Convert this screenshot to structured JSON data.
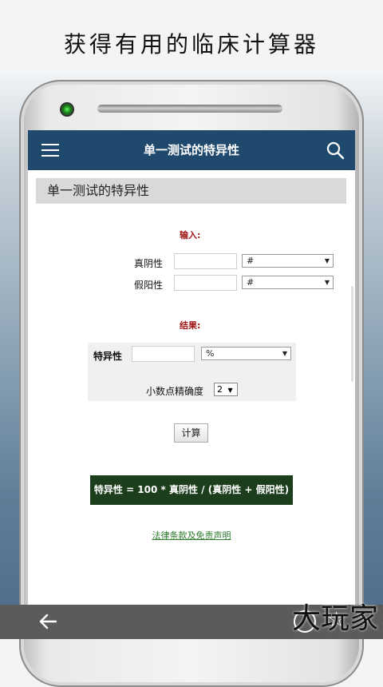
{
  "headline": "获得有用的临床计算器",
  "appbar": {
    "title": "单一测试的特异性"
  },
  "section_title": "单一测试的特异性",
  "input": {
    "heading": "输入:",
    "rows": [
      {
        "label": "真阴性",
        "value": "",
        "unit": "#"
      },
      {
        "label": "假阳性",
        "value": "",
        "unit": "#"
      }
    ]
  },
  "result": {
    "heading": "结果:",
    "label": "特异性",
    "value": "",
    "unit": "%",
    "precision_label": "小数点精确度",
    "precision_value": "2"
  },
  "calc_button": "计算",
  "formula": "特异性 = 100 * 真阴性 / (真阴性 + 假阳性)",
  "legal_link": "法律条款及免责声明",
  "watermark": "大玩家",
  "colors": {
    "appbar": "#1f4a6e",
    "formula_bg": "#1d3e1d",
    "heading_red": "#a01818",
    "link_green": "#2d7a2d"
  }
}
